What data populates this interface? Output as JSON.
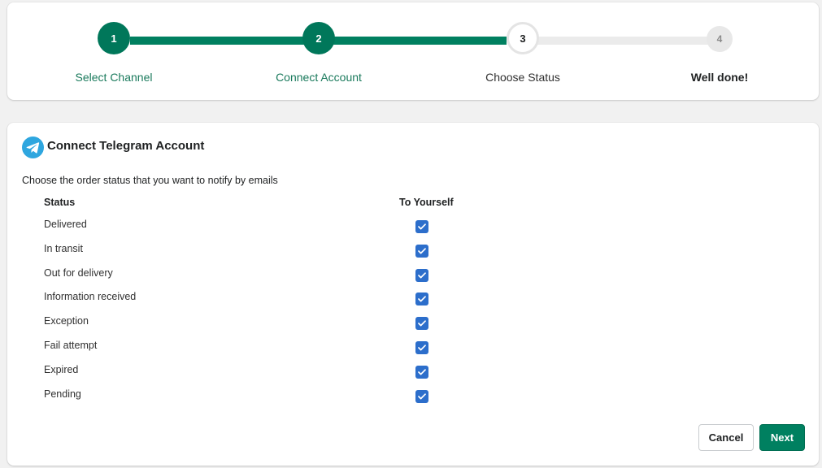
{
  "stepper": {
    "steps": [
      {
        "number": "1",
        "label": "Select Channel",
        "state": "done"
      },
      {
        "number": "2",
        "label": "Connect Account",
        "state": "done"
      },
      {
        "number": "3",
        "label": "Choose Status",
        "state": "current"
      },
      {
        "number": "4",
        "label": "Well done!",
        "state": "todo"
      }
    ]
  },
  "panel": {
    "icon": "telegram-icon",
    "title": "Connect Telegram Account",
    "description": "Choose the order status that you want to notify by emails",
    "columns": {
      "status": "Status",
      "to_yourself": "To Yourself"
    },
    "rows": [
      {
        "status": "Delivered",
        "checked": true
      },
      {
        "status": "In transit",
        "checked": true
      },
      {
        "status": "Out for delivery",
        "checked": true
      },
      {
        "status": "Information received",
        "checked": true
      },
      {
        "status": "Exception",
        "checked": true
      },
      {
        "status": "Fail attempt",
        "checked": true
      },
      {
        "status": "Expired",
        "checked": true
      },
      {
        "status": "Pending",
        "checked": true
      }
    ]
  },
  "actions": {
    "cancel_label": "Cancel",
    "next_label": "Next"
  },
  "colors": {
    "primary": "#008060",
    "checkbox": "#2c6ecb",
    "telegram": "#2ea6df"
  }
}
